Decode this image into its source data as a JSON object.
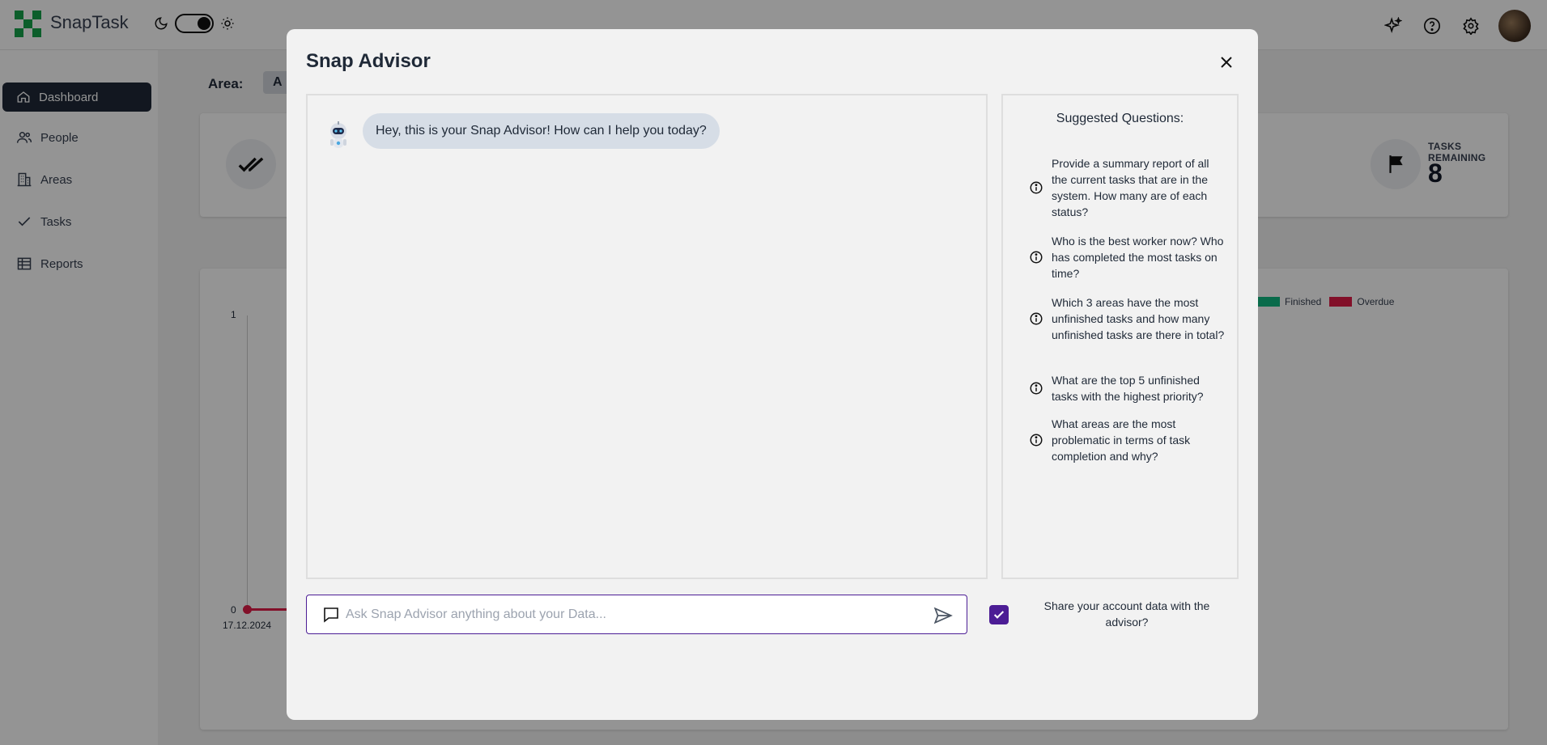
{
  "app": {
    "brand": "SnapTask"
  },
  "sidebar": {
    "items": [
      {
        "label": "Dashboard",
        "icon": "home-icon",
        "active": true
      },
      {
        "label": "People",
        "icon": "people-icon"
      },
      {
        "label": "Areas",
        "icon": "building-icon"
      },
      {
        "label": "Tasks",
        "icon": "check-icon"
      },
      {
        "label": "Reports",
        "icon": "table-icon"
      }
    ]
  },
  "dashboard": {
    "area_label": "Area:",
    "area_value": "A",
    "stats": [
      {
        "title": "TASKS REMAINING",
        "value": "8",
        "icon": "flag-icon"
      }
    ],
    "chart": {
      "y_ticks": [
        "1",
        "0"
      ],
      "x_ticks": [
        "17.12.2024"
      ],
      "legend": [
        {
          "label": "Finished",
          "color": "#10b981"
        },
        {
          "label": "Overdue",
          "color": "#e11d48"
        }
      ]
    }
  },
  "modal": {
    "title": "Snap Advisor",
    "greeting": "Hey, this is your Snap Advisor! How can I help you today?",
    "suggested_title": "Suggested Questions:",
    "questions": [
      "Provide a summary report of all the current tasks that are in the system. How many are of each status?",
      "Who is the best worker now? Who has completed the most tasks on time?",
      "Which 3 areas have the most unfinished tasks and how many unfinished tasks are there in total?",
      "What are the top 5 unfinished tasks with the highest priority?",
      "What areas are the most problematic in terms of task completion and why?"
    ],
    "input_placeholder": "Ask Snap Advisor anything about your Data...",
    "share_label": "Share your account data with the advisor?",
    "share_checked": true
  },
  "colors": {
    "accent": "#4c1d95",
    "brand": "#16a34a",
    "finished": "#10b981",
    "overdue": "#e11d48"
  }
}
